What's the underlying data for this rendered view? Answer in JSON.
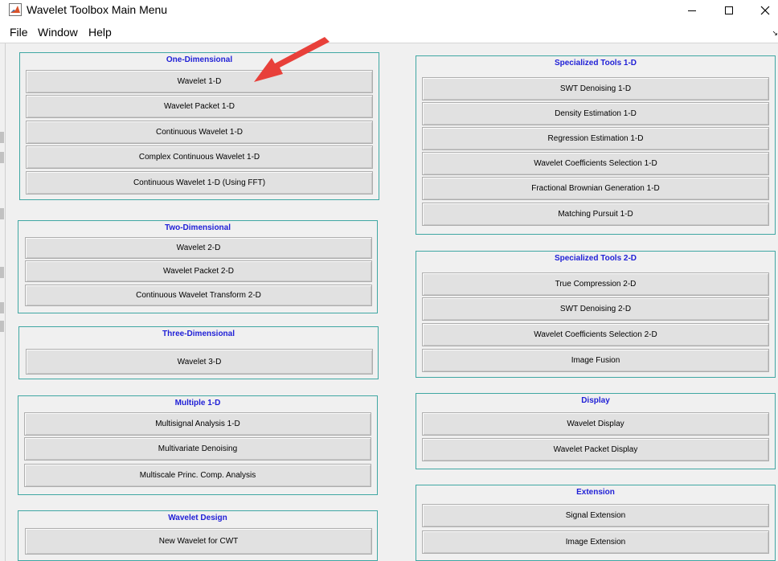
{
  "window": {
    "title": "Wavelet Toolbox Main Menu",
    "minimize_icon": "minimize-icon",
    "maximize_icon": "maximize-icon",
    "close_icon": "close-icon"
  },
  "menu": {
    "items": [
      "File",
      "Window",
      "Help"
    ],
    "corner": "↘"
  },
  "colors": {
    "panel_border": "#3fa7a3",
    "panel_title": "#1f1fd6",
    "annotation_arrow": "#e8403a"
  },
  "panels": {
    "one_d": {
      "title": "One-Dimensional",
      "buttons": [
        "Wavelet 1-D",
        "Wavelet Packet 1-D",
        "Continuous Wavelet 1-D",
        "Complex Continuous Wavelet 1-D",
        "Continuous Wavelet 1-D (Using FFT)"
      ]
    },
    "two_d": {
      "title": "Two-Dimensional",
      "buttons": [
        "Wavelet 2-D",
        "Wavelet Packet 2-D",
        "Continuous Wavelet Transform 2-D"
      ]
    },
    "three_d": {
      "title": "Three-Dimensional",
      "buttons": [
        "Wavelet 3-D"
      ]
    },
    "multiple_1d": {
      "title": "Multiple 1-D",
      "buttons": [
        "Multisignal Analysis 1-D",
        "Multivariate Denoising",
        "Multiscale Princ. Comp. Analysis"
      ]
    },
    "wavelet_design": {
      "title": "Wavelet Design",
      "buttons": [
        "New Wavelet for CWT"
      ]
    },
    "spec_1d": {
      "title": "Specialized Tools 1-D",
      "buttons": [
        "SWT Denoising 1-D",
        "Density Estimation 1-D",
        "Regression Estimation 1-D",
        "Wavelet Coefficients Selection 1-D",
        "Fractional Brownian Generation 1-D",
        "Matching Pursuit 1-D"
      ]
    },
    "spec_2d": {
      "title": "Specialized Tools 2-D",
      "buttons": [
        "True Compression 2-D",
        "SWT Denoising 2-D",
        "Wavelet Coefficients Selection 2-D",
        "Image Fusion"
      ]
    },
    "display": {
      "title": "Display",
      "buttons": [
        "Wavelet Display",
        "Wavelet Packet Display"
      ]
    },
    "extension": {
      "title": "Extension",
      "buttons": [
        "Signal Extension",
        "Image Extension"
      ]
    }
  }
}
